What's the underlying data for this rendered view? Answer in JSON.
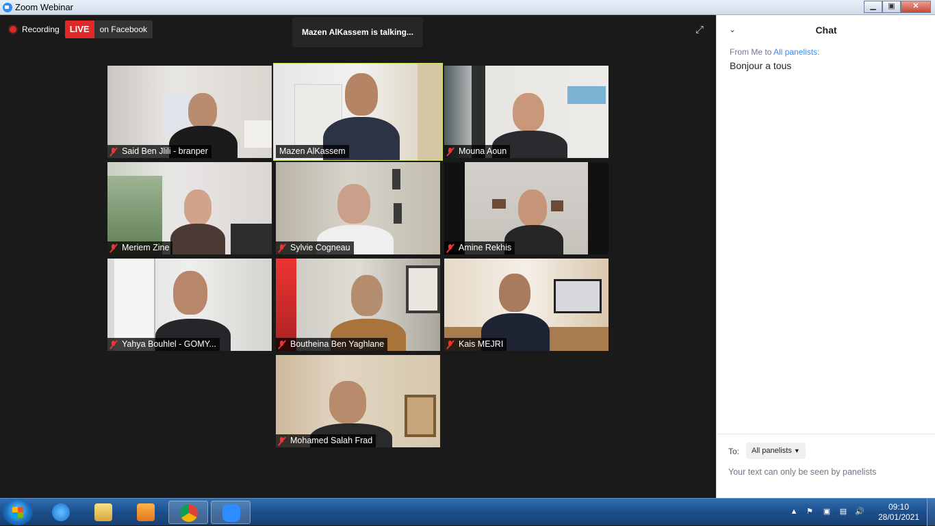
{
  "window": {
    "title": "Zoom Webinar"
  },
  "recording": {
    "label": "Recording",
    "live": "LIVE",
    "destination": "on Facebook"
  },
  "speaker_banner": "Mazen AlKassem is talking...",
  "participants": [
    {
      "name": "Said Ben Jlili - branper",
      "muted": true,
      "active": false
    },
    {
      "name": "Mazen AlKassem",
      "muted": false,
      "active": true
    },
    {
      "name": "Mouna Aoun",
      "muted": true,
      "active": false
    },
    {
      "name": "Meriem Zine",
      "muted": true,
      "active": false
    },
    {
      "name": "Sylvie Cogneau",
      "muted": true,
      "active": false
    },
    {
      "name": "Amine Rekhis",
      "muted": true,
      "active": false
    },
    {
      "name": "Yahya Bouhlel - GOMY...",
      "muted": true,
      "active": false
    },
    {
      "name": "Boutheina Ben Yaghlane",
      "muted": true,
      "active": false
    },
    {
      "name": "Kais MEJRI",
      "muted": true,
      "active": false
    },
    {
      "name": "Mohamed Salah Frad",
      "muted": true,
      "active": false
    }
  ],
  "chat": {
    "title": "Chat",
    "messages": [
      {
        "from_prefix": "From Me to ",
        "to": "All panelists",
        "to_suffix": ":",
        "text": "Bonjour a tous"
      }
    ],
    "footer": {
      "to_label": "To:",
      "recipient": "All panelists",
      "input_placeholder": "Your text can only be seen by panelists"
    }
  },
  "taskbar": {
    "apps": [
      "windows-explorer",
      "internet-explorer",
      "file-explorer",
      "media-player",
      "chrome",
      "zoom"
    ],
    "clock": {
      "time": "09:10",
      "date": "28/01/2021"
    }
  },
  "colors": {
    "active_speaker_border": "#d6e65a",
    "live_red": "#e02828",
    "zoom_blue": "#2d8cff"
  }
}
